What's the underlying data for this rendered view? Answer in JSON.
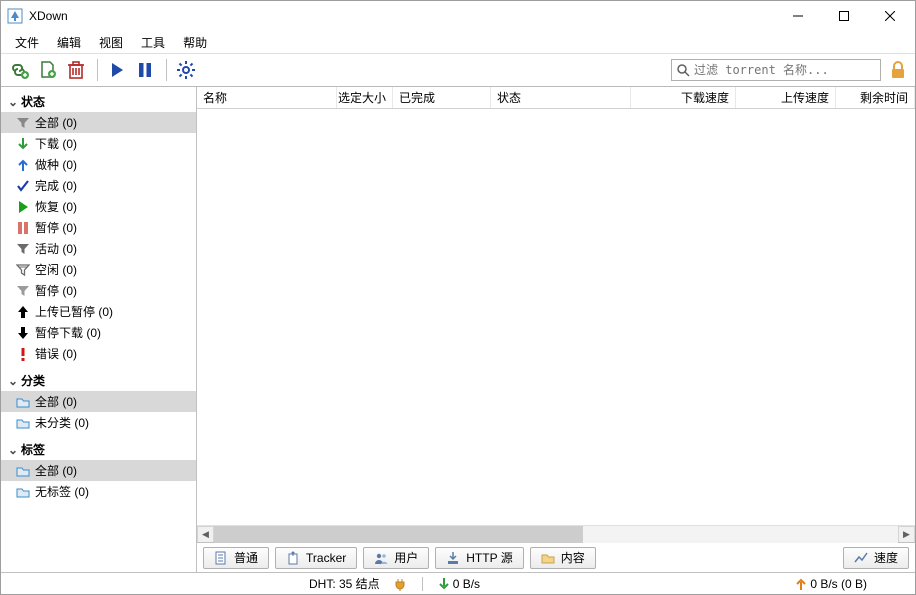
{
  "window": {
    "title": "XDown"
  },
  "menu": {
    "file": "文件",
    "edit": "编辑",
    "view": "视图",
    "tools": "工具",
    "help": "帮助"
  },
  "search": {
    "placeholder": "过滤 torrent 名称..."
  },
  "sidebar": {
    "status_header": "状态",
    "status": [
      {
        "label": "全部 (0)",
        "icon": "filter",
        "color": "#888888",
        "selected": true
      },
      {
        "label": "下载 (0)",
        "icon": "arrow-down",
        "color": "#2e9b3a"
      },
      {
        "label": "做种 (0)",
        "icon": "arrow-up",
        "color": "#2b6cd1"
      },
      {
        "label": "完成 (0)",
        "icon": "check",
        "color": "#1f3ea8"
      },
      {
        "label": "恢复 (0)",
        "icon": "play",
        "color": "#18a018"
      },
      {
        "label": "暂停 (0)",
        "icon": "pause",
        "color": "#d9746b"
      },
      {
        "label": "活动 (0)",
        "icon": "filter",
        "color": "#6b6b6b"
      },
      {
        "label": "空闲 (0)",
        "icon": "filter-stripe",
        "color": "#6b6b6b"
      },
      {
        "label": "暂停 (0)",
        "icon": "filter",
        "color": "#9b9b9b"
      },
      {
        "label": "上传已暂停 (0)",
        "icon": "arrow-up-bold",
        "color": "#000000"
      },
      {
        "label": "暂停下载 (0)",
        "icon": "arrow-down-bold",
        "color": "#000000"
      },
      {
        "label": "错误 (0)",
        "icon": "exclaim",
        "color": "#d11616"
      }
    ],
    "category_header": "分类",
    "category": [
      {
        "label": "全部 (0)",
        "icon": "folder",
        "color": "#3a8dc7",
        "selected": true
      },
      {
        "label": "未分类 (0)",
        "icon": "folder",
        "color": "#3a8dc7"
      }
    ],
    "tags_header": "标签",
    "tags": [
      {
        "label": "全部 (0)",
        "icon": "folder",
        "color": "#3a8dc7",
        "selected": true
      },
      {
        "label": "无标签 (0)",
        "icon": "folder",
        "color": "#3a8dc7"
      }
    ]
  },
  "columns": {
    "name": "名称",
    "selected_size": "选定大小",
    "completed": "已完成",
    "status": "状态",
    "down_speed": "下载速度",
    "up_speed": "上传速度",
    "eta": "剩余时间"
  },
  "tabs": {
    "general": "普通",
    "tracker": "Tracker",
    "users": "用户",
    "http": "HTTP 源",
    "content": "内容",
    "speed": "速度"
  },
  "status": {
    "dht": "DHT: 35 结点",
    "down": "0 B/s",
    "up": "0 B/s (0 B)"
  }
}
